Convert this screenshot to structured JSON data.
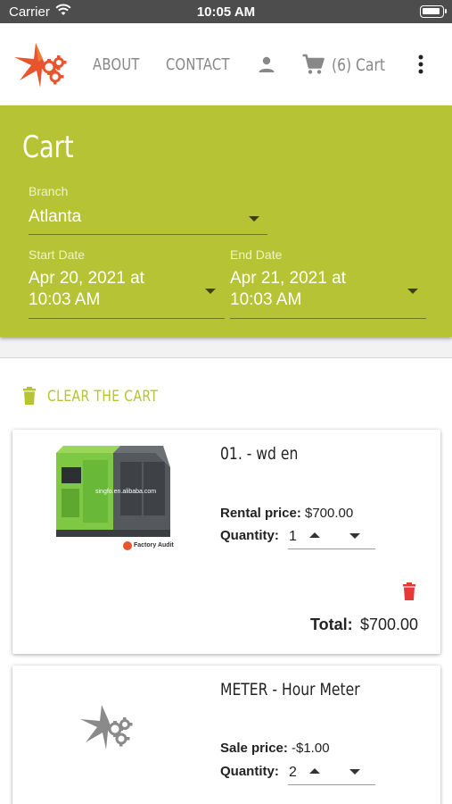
{
  "status_bar": {
    "carrier": "Carrier",
    "time": "10:05 AM"
  },
  "nav": {
    "logo_icon": "starburst-gears-logo",
    "about": "ABOUT",
    "contact": "CONTACT",
    "account_icon": "person-icon",
    "cart_icon": "shopping-cart-icon",
    "cart_label": "(6) Cart",
    "menu_icon": "more-vert-icon",
    "link_color": "#888888"
  },
  "cart_header": {
    "title": "Cart",
    "background": "#b5c334",
    "branch": {
      "label": "Branch",
      "value": "Atlanta"
    },
    "start_date": {
      "label": "Start Date",
      "value_line1": "Apr 20, 2021 at",
      "value_line2": "10:03 AM"
    },
    "end_date": {
      "label": "End Date",
      "value_line1": "Apr 21, 2021 at",
      "value_line2": "10:03 AM"
    }
  },
  "cart": {
    "clear_label": "CLEAR THE CART",
    "clear_icon": "trash-icon",
    "accent": "#b5c334",
    "items": [
      {
        "name": "01. - wd en",
        "image": "green-generator-photo",
        "image_watermark": "singfo.en.alibaba.com",
        "image_badge": "Factory Audit",
        "price_label": "Rental price:",
        "price": "$700.00",
        "quantity_label": "Quantity:",
        "quantity": "1",
        "delete_icon": "trash-icon",
        "delete_color": "#e53935",
        "total_label": "Total:",
        "total": "$700.00"
      },
      {
        "name": "METER - Hour Meter",
        "image": "placeholder-logo",
        "price_label": "Sale price:",
        "price": "-$1.00",
        "quantity_label": "Quantity:",
        "quantity": "2"
      }
    ]
  }
}
